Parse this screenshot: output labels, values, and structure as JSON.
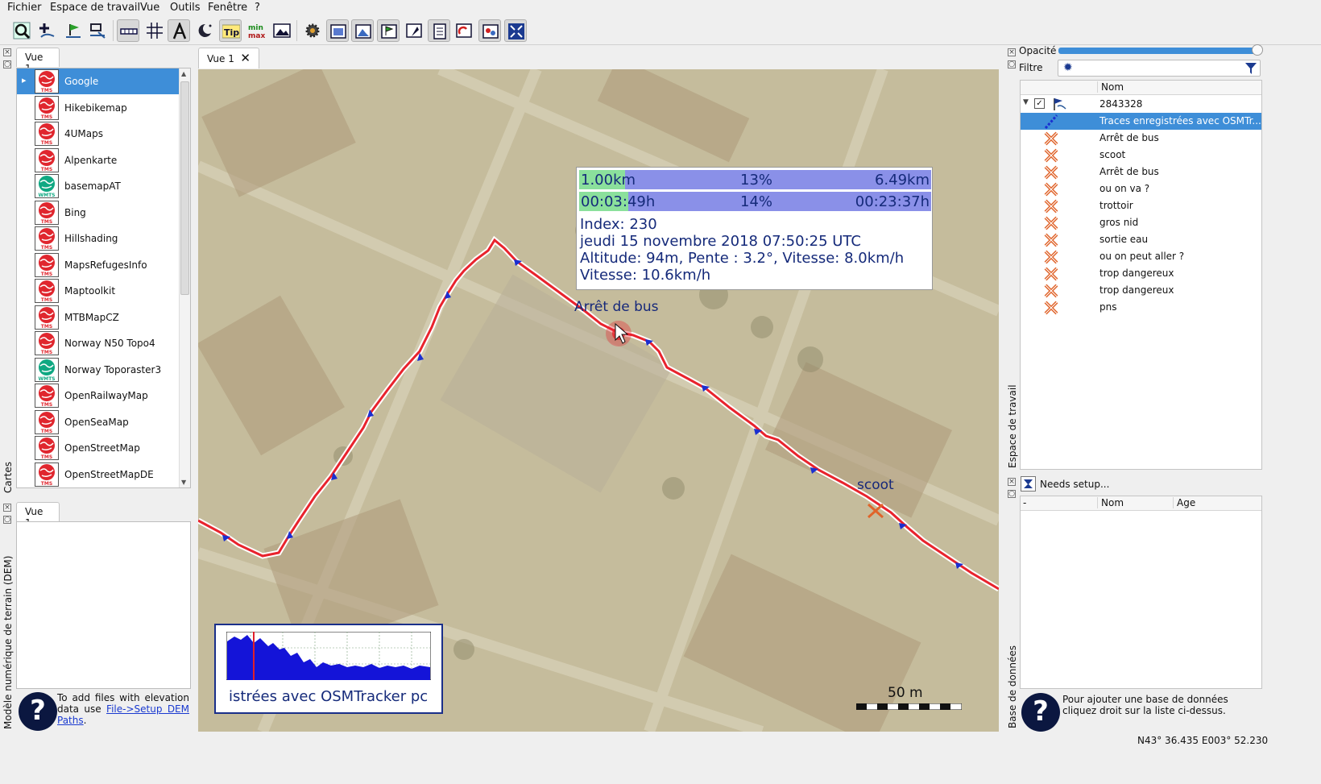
{
  "menu": [
    "Fichier",
    "Espace de travail",
    "Vue",
    "Outils",
    "Fenêtre",
    "?"
  ],
  "toolbar_icons": [
    "zoom-search-icon",
    "add-waypoint-icon",
    "add-route-icon",
    "edit-route-icon",
    "ruler-icon",
    "grid-icon",
    "text-tool-icon",
    "night-mode-icon",
    "tip-icon",
    "min-max-icon",
    "image-icon",
    "settings-gear-icon",
    "window1-icon",
    "window2-icon",
    "window3-icon",
    "window4-icon",
    "window5-icon",
    "window6-icon",
    "window7-icon",
    "fullscreen-icon"
  ],
  "left_dock": {
    "tab": "Vue 1",
    "side_label": "Cartes",
    "maps": [
      {
        "name": "Google",
        "type": "TMS"
      },
      {
        "name": "Hikebikemap",
        "type": "TMS"
      },
      {
        "name": "4UMaps",
        "type": "TMS"
      },
      {
        "name": "Alpenkarte",
        "type": "TMS"
      },
      {
        "name": "basemapAT",
        "type": "WMTS"
      },
      {
        "name": "Bing",
        "type": "TMS"
      },
      {
        "name": "Hillshading",
        "type": "TMS"
      },
      {
        "name": "MapsRefugesInfo",
        "type": "TMS"
      },
      {
        "name": "Maptoolkit",
        "type": "TMS"
      },
      {
        "name": "MTBMapCZ",
        "type": "TMS"
      },
      {
        "name": "Norway N50 Topo4",
        "type": "TMS"
      },
      {
        "name": "Norway Toporaster3",
        "type": "WMTS"
      },
      {
        "name": "OpenRailwayMap",
        "type": "TMS"
      },
      {
        "name": "OpenSeaMap",
        "type": "TMS"
      },
      {
        "name": "OpenStreetMap",
        "type": "TMS"
      },
      {
        "name": "OpenStreetMapDE",
        "type": "TMS"
      }
    ]
  },
  "dem_dock": {
    "tab": "Vue 1",
    "side_label": "Modèle numérique de terrain (DEM)",
    "help_prefix": "To add files with elevation data use ",
    "help_link": "File->Setup DEM Paths",
    "help_suffix": "."
  },
  "map_view": {
    "tab": "Vue 1",
    "popup": {
      "dist_done": "1.00km",
      "dist_pct": "13%",
      "dist_total": "6.49km",
      "dist_fraction": 0.13,
      "time_done": "00:03:49h",
      "time_pct": "14%",
      "time_total": "00:23:37h",
      "time_fraction": 0.14,
      "index": "Index: 230",
      "date": "jeudi 15 novembre 2018 07:50:25 UTC",
      "altitude": "Altitude: 94m, Pente : 3.2°, Vitesse: 8.0km/h",
      "speed": "Vitesse: 10.6km/h"
    },
    "labels": {
      "bus_stop": "Arrêt de bus",
      "scoot": "scoot"
    },
    "mini_chart_caption": "istrées avec OSMTracker pc",
    "scale_label": "50 m",
    "colors": {
      "track": "#e8232d",
      "direction_arrow": "#1a2fd0",
      "popup_bar": "#8a90e8",
      "popup_fill": "#8be09c"
    }
  },
  "right_dock": {
    "opacity_label": "Opacité",
    "filter_label": "Filtre",
    "side_label_ws": "Espace de travail",
    "column_name": "Nom",
    "project": "2843328",
    "items": [
      {
        "name": "Traces enregistrées avec OSMTr...",
        "kind": "track",
        "selected": true
      },
      {
        "name": "Arrêt de bus",
        "kind": "waypoint"
      },
      {
        "name": "scoot",
        "kind": "waypoint"
      },
      {
        "name": "Arrêt de bus",
        "kind": "waypoint"
      },
      {
        "name": "ou on va ?",
        "kind": "waypoint"
      },
      {
        "name": "trottoir",
        "kind": "waypoint"
      },
      {
        "name": "gros nid",
        "kind": "waypoint"
      },
      {
        "name": "sortie eau",
        "kind": "waypoint"
      },
      {
        "name": "ou on peut aller ?",
        "kind": "waypoint"
      },
      {
        "name": "trop dangereux",
        "kind": "waypoint"
      },
      {
        "name": "trop dangereux",
        "kind": "waypoint"
      },
      {
        "name": "pns",
        "kind": "waypoint"
      }
    ],
    "db_setup": "Needs setup...",
    "db_columns": [
      "-",
      "Nom",
      "Age"
    ],
    "side_label_db": "Base de données",
    "db_help": "Pour ajouter une base de données cliquez droit sur la liste ci-dessus."
  },
  "status_coords": "N43° 36.435 E003° 52.230"
}
